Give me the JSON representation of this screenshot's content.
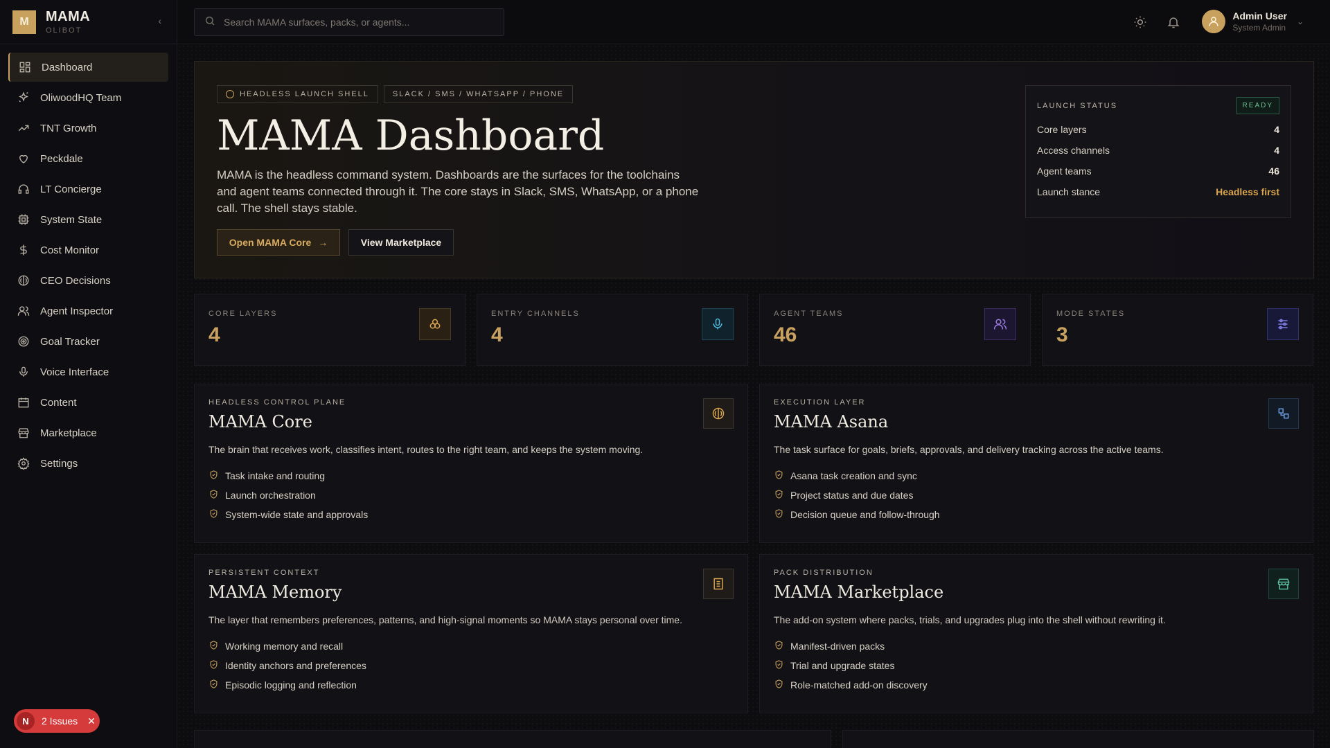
{
  "brand": {
    "logo_letter": "M",
    "name": "MAMA",
    "subtitle": "OLIBOT"
  },
  "sidebar": {
    "items": [
      {
        "label": "Dashboard",
        "icon": "grid-icon",
        "active": true
      },
      {
        "label": "OliwoodHQ Team",
        "icon": "sparkles-icon"
      },
      {
        "label": "TNT Growth",
        "icon": "trending-up-icon"
      },
      {
        "label": "Peckdale",
        "icon": "heart-icon"
      },
      {
        "label": "LT Concierge",
        "icon": "headphones-icon"
      },
      {
        "label": "System State",
        "icon": "cpu-icon"
      },
      {
        "label": "Cost Monitor",
        "icon": "dollar-icon"
      },
      {
        "label": "CEO Decisions",
        "icon": "brain-icon"
      },
      {
        "label": "Agent Inspector",
        "icon": "users-icon"
      },
      {
        "label": "Goal Tracker",
        "icon": "target-icon"
      },
      {
        "label": "Voice Interface",
        "icon": "mic-icon"
      },
      {
        "label": "Content",
        "icon": "calendar-icon"
      },
      {
        "label": "Marketplace",
        "icon": "store-icon"
      },
      {
        "label": "Settings",
        "icon": "gear-icon"
      }
    ]
  },
  "issues": {
    "letter": "N",
    "label": "2 Issues"
  },
  "search": {
    "placeholder": "Search MAMA surfaces, packs, or agents..."
  },
  "user": {
    "name": "Admin User",
    "role": "System Admin"
  },
  "hero": {
    "chips": [
      "HEADLESS LAUNCH SHELL",
      "SLACK / SMS / WHATSAPP / PHONE"
    ],
    "title": "MAMA Dashboard",
    "description": "MAMA is the headless command system. Dashboards are the surfaces for the toolchains and agent teams connected through it. The core stays in Slack, SMS, WhatsApp, or a phone call. The shell stays stable.",
    "primary_button": "Open MAMA Core",
    "secondary_button": "View Marketplace"
  },
  "launch_status": {
    "title": "LAUNCH STATUS",
    "badge": "READY",
    "rows": [
      {
        "label": "Core layers",
        "value": "4"
      },
      {
        "label": "Access channels",
        "value": "4"
      },
      {
        "label": "Agent teams",
        "value": "46"
      },
      {
        "label": "Launch stance",
        "value": "Headless first"
      }
    ]
  },
  "stats": [
    {
      "label": "CORE LAYERS",
      "value": "4",
      "icon": "layers-icon",
      "color": "#d9a54f"
    },
    {
      "label": "ENTRY CHANNELS",
      "value": "4",
      "icon": "mic-icon",
      "color": "#4fb6d9"
    },
    {
      "label": "AGENT TEAMS",
      "value": "46",
      "icon": "users-icon",
      "color": "#9a7be0"
    },
    {
      "label": "MODE STATES",
      "value": "3",
      "icon": "sliders-icon",
      "color": "#7c7be0"
    }
  ],
  "cards": [
    {
      "kicker": "HEADLESS CONTROL PLANE",
      "title": "MAMA Core",
      "description": "The brain that receives work, classifies intent, routes to the right team, and keeps the system moving.",
      "items": [
        "Task intake and routing",
        "Launch orchestration",
        "System-wide state and approvals"
      ],
      "icon": "brain-icon"
    },
    {
      "kicker": "EXECUTION LAYER",
      "title": "MAMA Asana",
      "description": "The task surface for goals, briefs, approvals, and delivery tracking across the active teams.",
      "items": [
        "Asana task creation and sync",
        "Project status and due dates",
        "Decision queue and follow-through"
      ],
      "icon": "workflow-icon"
    },
    {
      "kicker": "PERSISTENT CONTEXT",
      "title": "MAMA Memory",
      "description": "The layer that remembers preferences, patterns, and high-signal moments so MAMA stays personal over time.",
      "items": [
        "Working memory and recall",
        "Identity anchors and preferences",
        "Episodic logging and reflection"
      ],
      "icon": "notebook-icon"
    },
    {
      "kicker": "PACK DISTRIBUTION",
      "title": "MAMA Marketplace",
      "description": "The add-on system where packs, trials, and upgrades plug into the shell without rewriting it.",
      "items": [
        "Manifest-driven packs",
        "Trial and upgrade states",
        "Role-matched add-on discovery"
      ],
      "icon": "store-icon"
    }
  ],
  "colors": {
    "accent": "#c9a15f",
    "background": "#0b0a0d",
    "ready": "#6fbf9a",
    "issues": "#d63b3b"
  }
}
